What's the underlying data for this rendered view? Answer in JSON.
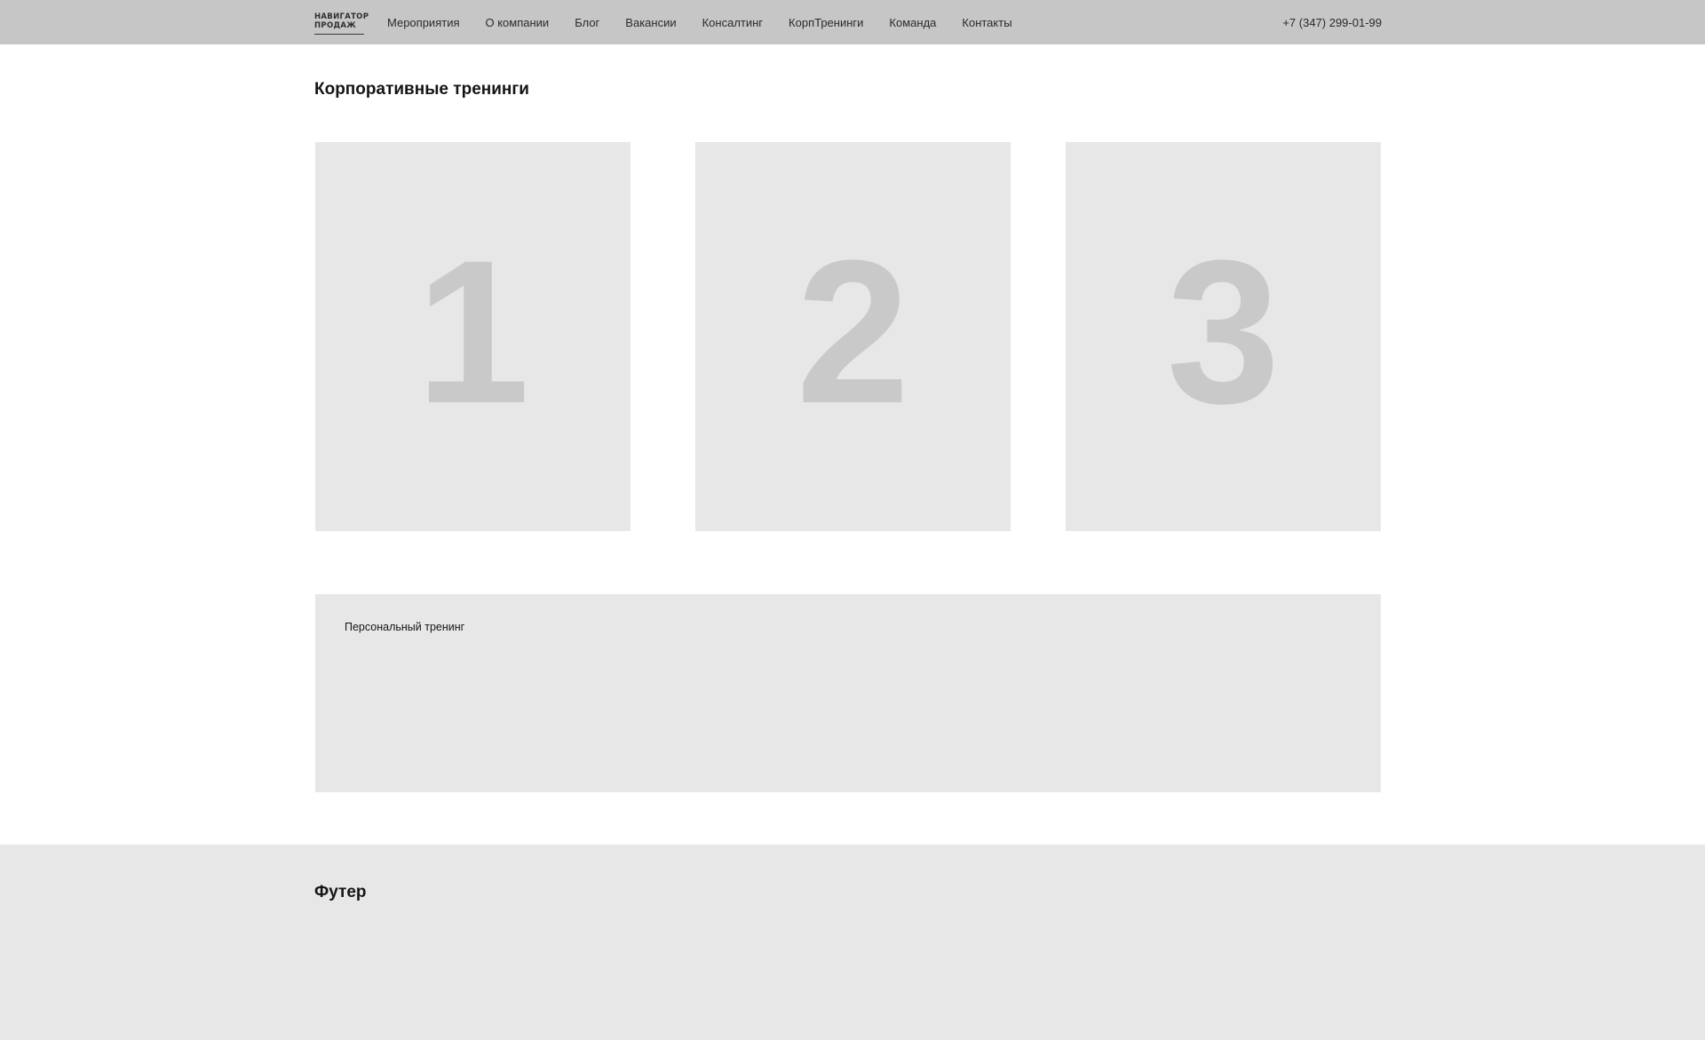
{
  "header": {
    "logo_line1": "НАВИГАТОР",
    "logo_line2": "ПРОДАЖ",
    "nav": [
      "Мероприятия",
      "О компании",
      "Блог",
      "Вакансии",
      "Консалтинг",
      "КорпТренинги",
      "Команда",
      "Контакты"
    ],
    "phone": "+7 (347) 299-01-99"
  },
  "main": {
    "title": "Корпоративные тренинги",
    "cards": [
      "1",
      "2",
      "3"
    ],
    "personal_label": "Персональный тренинг"
  },
  "footer": {
    "title": "Футер"
  },
  "colors": {
    "header_bg": "#c6c6c6",
    "card_bg": "#e7e7e7",
    "card_number": "#c9c9c9"
  }
}
